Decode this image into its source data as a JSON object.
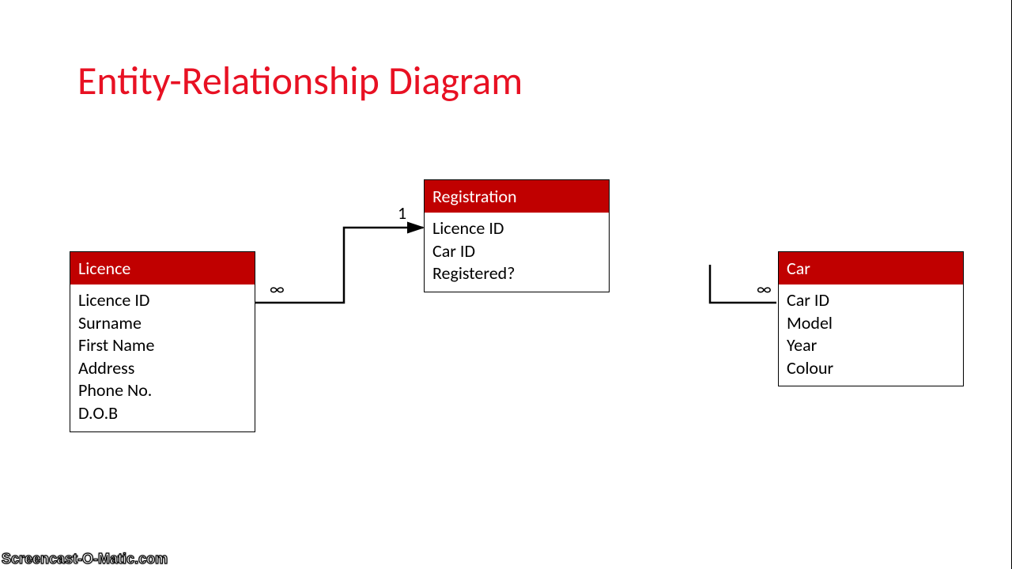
{
  "title": "Entity-Relationship Diagram",
  "watermark": "Screencast-O-Matic.com",
  "cardinality": {
    "licence_side": "∞",
    "registration_side": "1",
    "car_side": "∞"
  },
  "entities": {
    "licence": {
      "title": "Licence",
      "attrs": [
        "Licence ID",
        "Surname",
        "First Name",
        "Address",
        "Phone No.",
        "D.O.B"
      ]
    },
    "registration": {
      "title": "Registration",
      "attrs": [
        "Licence ID",
        "Car ID",
        "Registered?"
      ]
    },
    "car": {
      "title": "Car",
      "attrs": [
        "Car ID",
        "Model",
        "Year",
        "Colour"
      ]
    }
  }
}
